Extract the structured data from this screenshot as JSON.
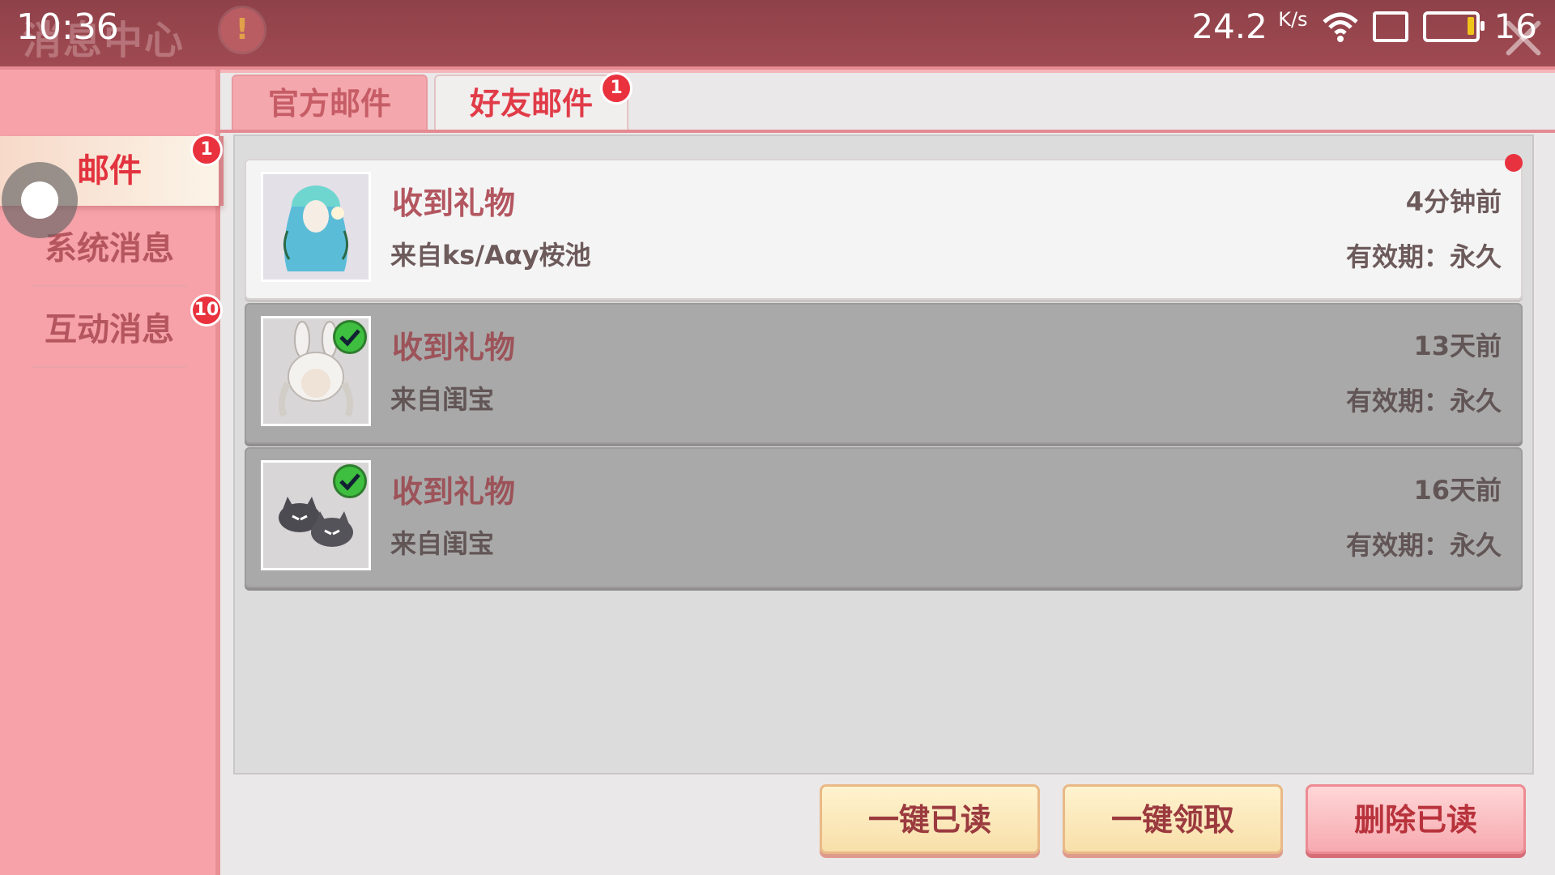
{
  "status_bar": {
    "time": "10:36",
    "net_speed": "24.2",
    "net_unit": "K/s",
    "battery": "16"
  },
  "header": {
    "title": "消息中心",
    "warn_glyph": "!"
  },
  "sidebar": {
    "items": [
      {
        "label": "邮件",
        "badge": "1",
        "active": true
      },
      {
        "label": "系统消息",
        "badge": ""
      },
      {
        "label": "互动消息",
        "badge": "10"
      }
    ]
  },
  "tabs": [
    {
      "label": "官方邮件",
      "badge": ""
    },
    {
      "label": "好友邮件",
      "badge": "1",
      "active": true
    }
  ],
  "mails": [
    {
      "title": "收到礼物",
      "from": "来自ks/Aαy桉池",
      "time": "4分钟前",
      "validity": "有效期：永久",
      "read": false,
      "thumb": "teal-hair-gift"
    },
    {
      "title": "收到礼物",
      "from": "来自闺宝",
      "time": "13天前",
      "validity": "有效期：永久",
      "read": true,
      "thumb": "bunny-hair-gift"
    },
    {
      "title": "收到礼物",
      "from": "来自闺宝",
      "time": "16天前",
      "validity": "有效期：永久",
      "read": true,
      "thumb": "cat-slippers-gift"
    }
  ],
  "actions": {
    "read_all": "一键已读",
    "claim_all": "一键领取",
    "delete_read": "删除已读"
  },
  "colors": {
    "header": "#9a4750",
    "sidebar": "#f6a2a8",
    "active_text": "#e2333e",
    "badge": "#e9323e"
  }
}
